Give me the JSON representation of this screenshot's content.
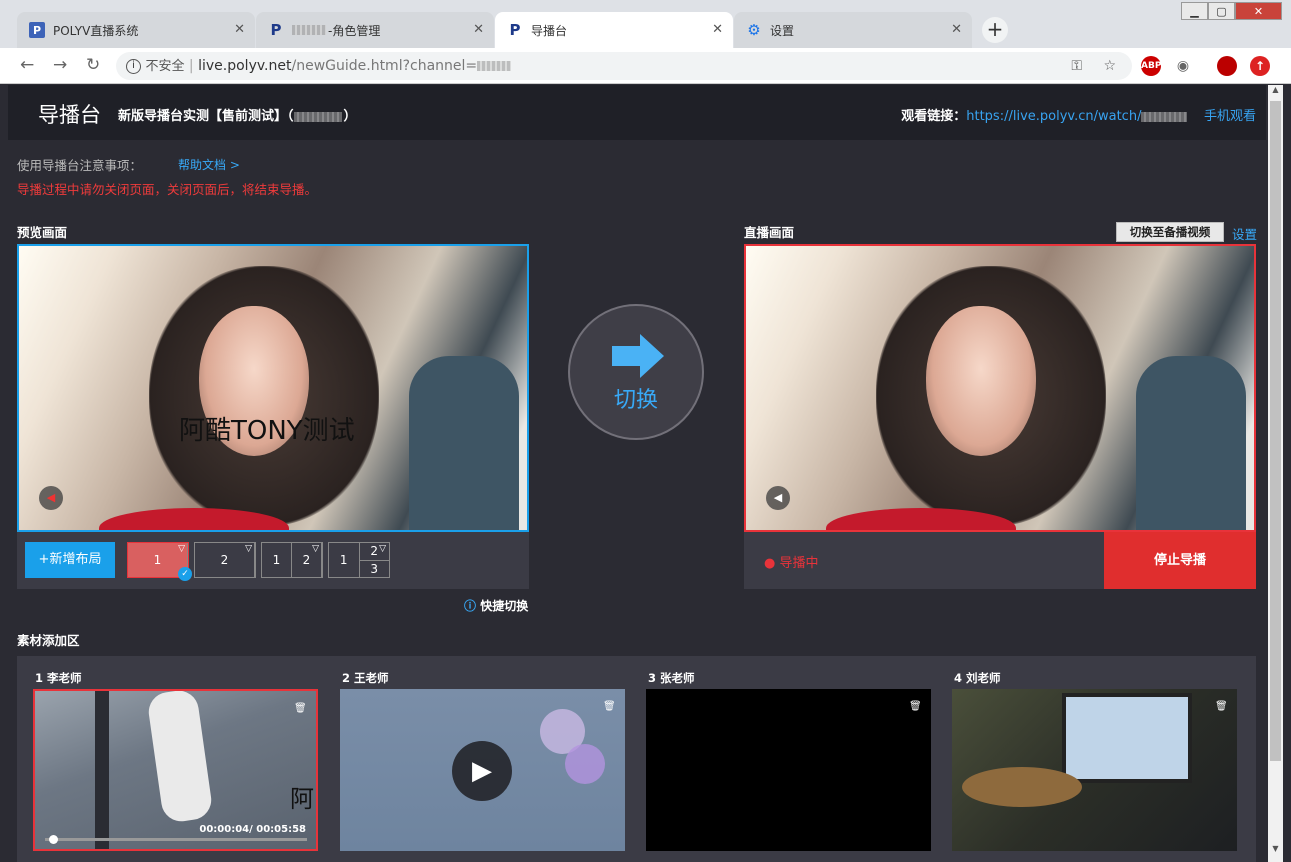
{
  "browser": {
    "tabs": [
      {
        "label": "POLYV直播系统"
      },
      {
        "label": "-角色管理"
      },
      {
        "label": "导播台"
      },
      {
        "label": "设置"
      }
    ],
    "insecure_label": "不安全",
    "url_host": "live.polyv.net",
    "url_path": "/newGuide.html?channel="
  },
  "header": {
    "title": "导播台",
    "subtitle_prefix": "新版导播台实测【售前测试】（",
    "subtitle_suffix": "）",
    "watch_label": "观看链接：",
    "watch_url": "https://live.polyv.cn/watch/",
    "mobile_watch": "手机观看"
  },
  "notice": {
    "label": "使用导播台注意事项：",
    "help_link": "帮助文档 >",
    "warning": "导播过程中请勿关闭页面，关闭页面后，将结束导播。"
  },
  "preview": {
    "label": "预览画面",
    "overlay_text": "阿酷TONY测试",
    "add_layout": "+新增布局",
    "layouts": [
      {
        "cells": [
          "1"
        ]
      },
      {
        "cells": [
          "2"
        ]
      },
      {
        "cells": [
          "1",
          "2"
        ]
      },
      {
        "cells": [
          "1",
          "2",
          "3"
        ]
      }
    ],
    "quick_switch": "快捷切换"
  },
  "switch": {
    "label": "切换"
  },
  "live": {
    "label": "直播画面",
    "backup_button": "切换至备播视频",
    "settings_link": "设置",
    "status": "导播中",
    "stop_button": "停止导播"
  },
  "materials": {
    "label": "素材添加区",
    "items": [
      {
        "title": "1 李老师",
        "overlay": "阿",
        "time": "00:00:04/ 00:05:58"
      },
      {
        "title": "2 王老师"
      },
      {
        "title": "3 张老师"
      },
      {
        "title": "4 刘老师"
      }
    ]
  },
  "colors": {
    "accent_blue": "#1aa0ea",
    "live_red": "#e8333a",
    "stop_red": "#e02e2e",
    "background": "#2b2b33"
  }
}
